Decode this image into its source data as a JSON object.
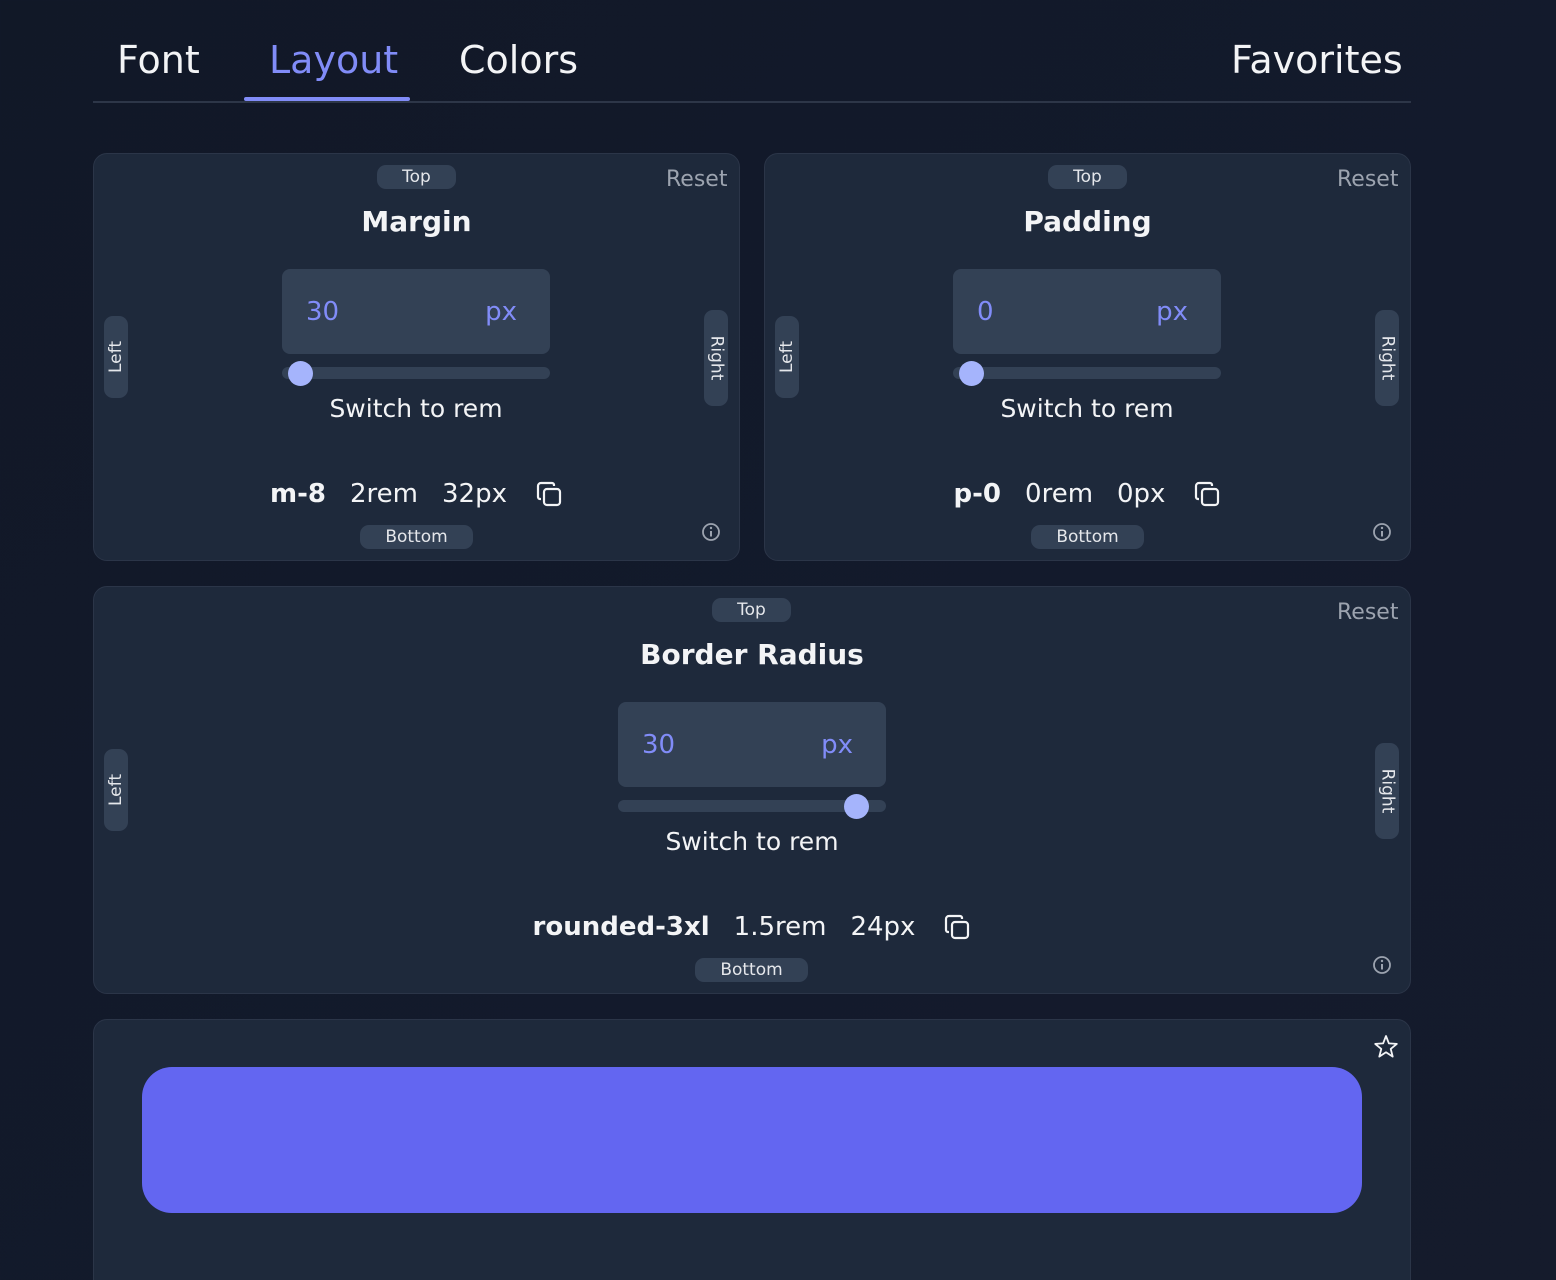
{
  "tabs": [
    {
      "label": "Font"
    },
    {
      "label": "Layout"
    },
    {
      "label": "Colors"
    },
    {
      "label": "Favorites"
    }
  ],
  "active_tab": "Layout",
  "accent_color": "#818cf8",
  "preview_color": "#6366f1",
  "common": {
    "top": "Top",
    "bottom": "Bottom",
    "left": "Left",
    "right": "Right",
    "reset": "Reset",
    "switch": "Switch to rem"
  },
  "margin": {
    "title": "Margin",
    "value": "30",
    "unit": "px",
    "slider_fraction": 0.0,
    "class_name": "m-8",
    "rem": "2rem",
    "px": "32px"
  },
  "padding": {
    "title": "Padding",
    "value": "0",
    "unit": "px",
    "slider_fraction": 0.0,
    "class_name": "p-0",
    "rem": "0rem",
    "px": "0px"
  },
  "radius": {
    "title": "Border Radius",
    "value": "30",
    "unit": "px",
    "slider_fraction": 0.93,
    "class_name": "rounded-3xl",
    "rem": "1.5rem",
    "px": "24px"
  },
  "icons": {
    "copy": "copy-icon",
    "info": "info-icon",
    "favorite": "star-icon"
  }
}
